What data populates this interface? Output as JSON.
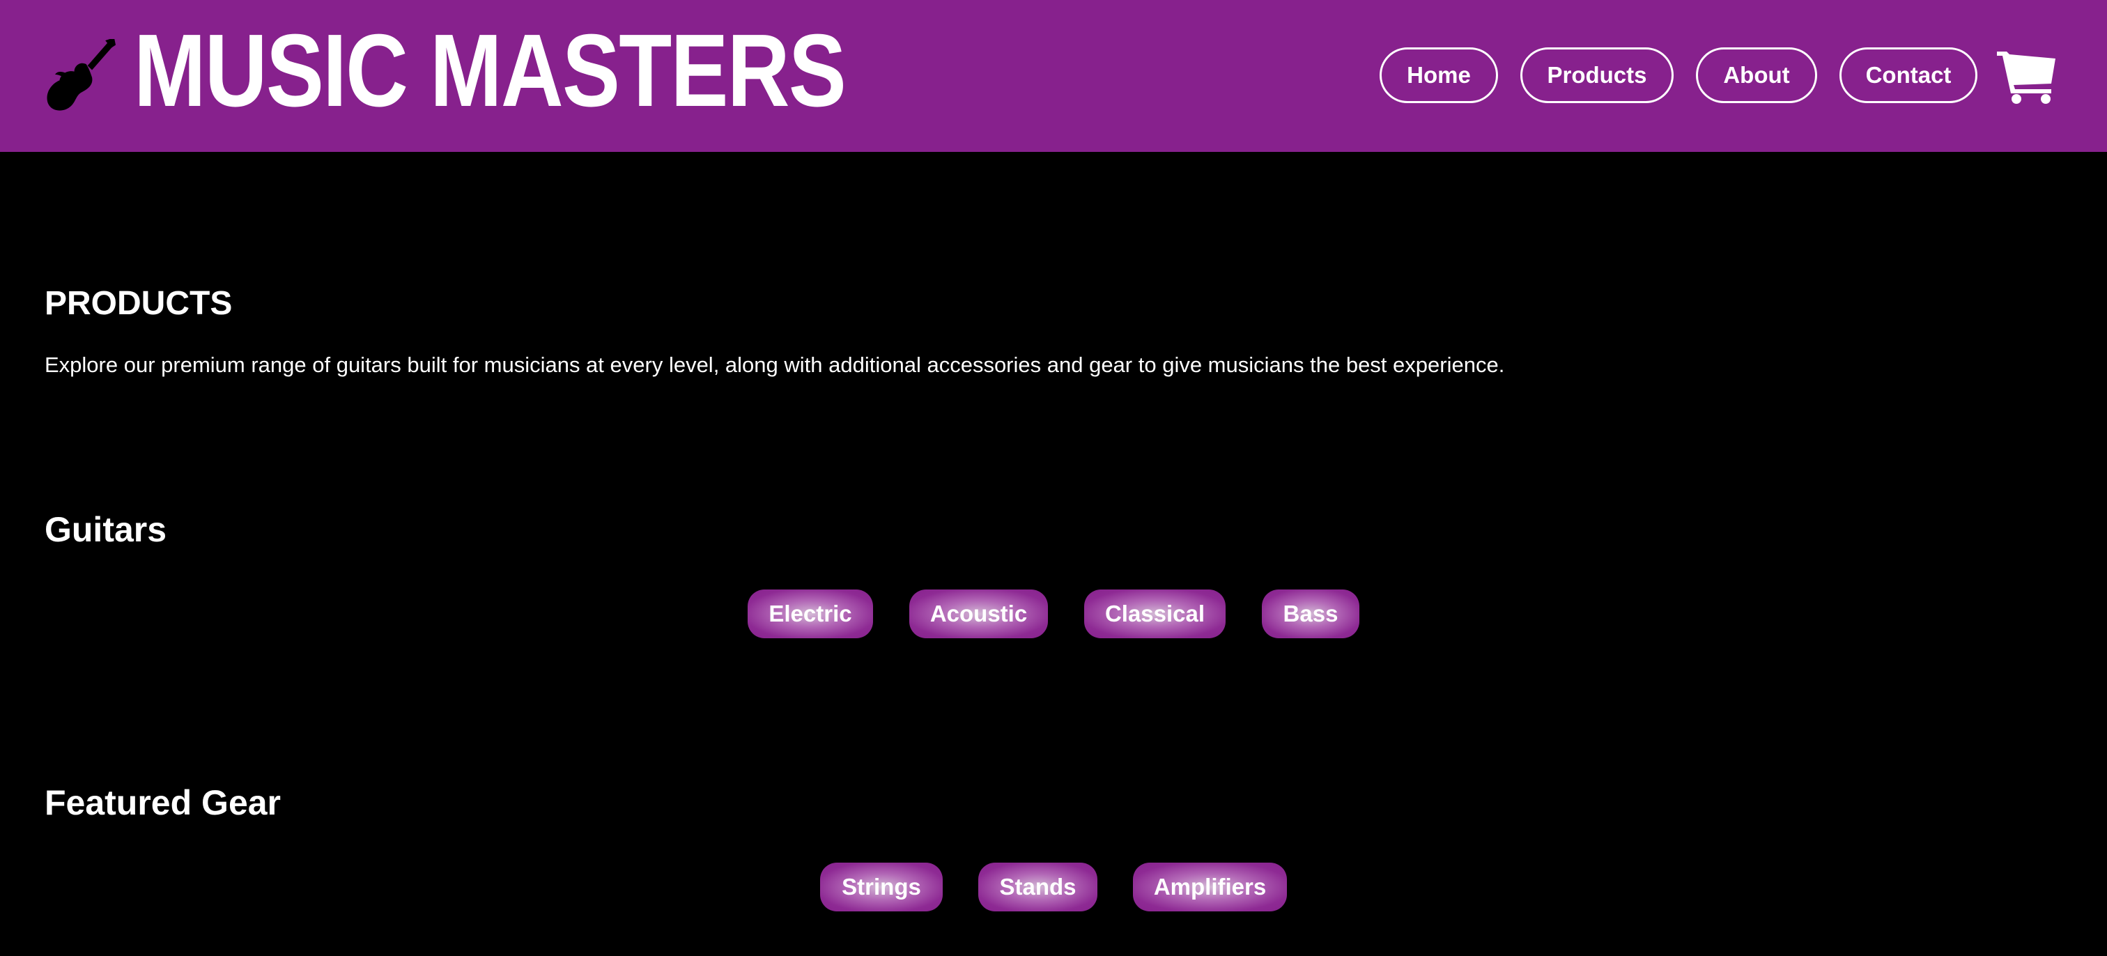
{
  "header": {
    "brand": "MUSIC MASTERS",
    "logo_icon": "electric-guitar-icon",
    "cart_icon": "shopping-cart-icon",
    "nav": [
      {
        "label": "Home"
      },
      {
        "label": "Products"
      },
      {
        "label": "About"
      },
      {
        "label": "Contact"
      }
    ]
  },
  "intro": {
    "title": "PRODUCTS",
    "description": "Explore our premium range of guitars built for musicians at every level, along with additional accessories and gear to give musicians the best experience."
  },
  "guitars": {
    "title": "Guitars",
    "items": [
      {
        "label": "Electric"
      },
      {
        "label": "Acoustic"
      },
      {
        "label": "Classical"
      },
      {
        "label": "Bass"
      }
    ]
  },
  "gear": {
    "title": "Featured Gear",
    "items": [
      {
        "label": "Strings"
      },
      {
        "label": "Stands"
      },
      {
        "label": "Amplifiers"
      }
    ]
  },
  "colors": {
    "header_bg": "#87218d",
    "page_bg": "#000000",
    "text": "#ffffff"
  }
}
